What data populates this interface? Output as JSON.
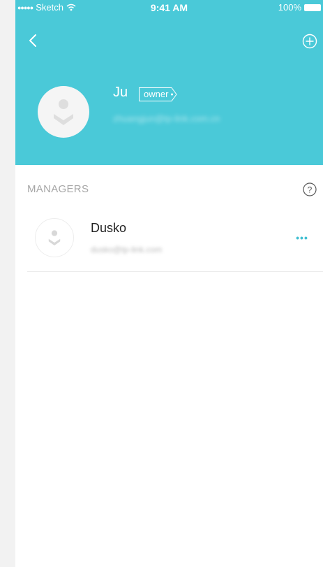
{
  "status_bar": {
    "carrier_signal": "●●●●●",
    "carrier": "Sketch",
    "time": "9:41 AM",
    "battery": "100%"
  },
  "header": {
    "owner": {
      "name": "Ju",
      "role": "owner",
      "email": "zhuangjun@tp-link.com.cn",
      "avatar_icon": "user-avatar-icon"
    },
    "back_icon": "chevron-left-icon",
    "add_icon": "add-circle-icon"
  },
  "managers": {
    "title": "MANAGERS",
    "help_icon": "help-circle-icon",
    "items": [
      {
        "name": "Dusko",
        "email": "dusko@tp-link.com",
        "avatar_icon": "user-avatar-icon",
        "more_label": "•••"
      }
    ]
  },
  "colors": {
    "header_bg": "#4ac9d8",
    "accent": "#41bfd2",
    "page_bg": "#ffffff"
  }
}
